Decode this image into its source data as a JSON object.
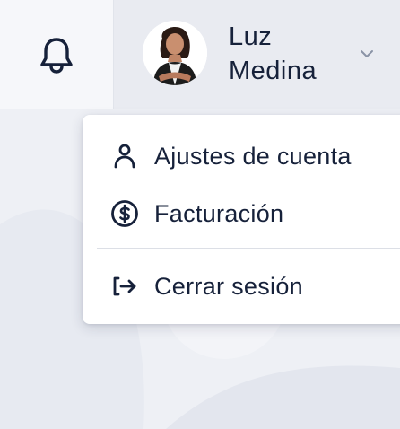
{
  "header": {
    "notifications_icon": "bell-icon",
    "user": {
      "first_name": "Luz",
      "last_name": "Medina",
      "avatar": "user-avatar-photo",
      "menu_icon": "chevron-down-icon"
    }
  },
  "dropdown": {
    "items": [
      {
        "label": "Ajustes de cuenta",
        "icon": "user-icon"
      },
      {
        "label": "Facturación",
        "icon": "dollar-circle-icon"
      },
      {
        "label": "Cerrar sesión",
        "icon": "logout-icon"
      }
    ]
  },
  "colors": {
    "text": "#16213a",
    "topbar": "#e9ebf1",
    "bell_area": "#f6f7fa",
    "page_background": "#eef0f5",
    "menu_background": "#ffffff"
  }
}
